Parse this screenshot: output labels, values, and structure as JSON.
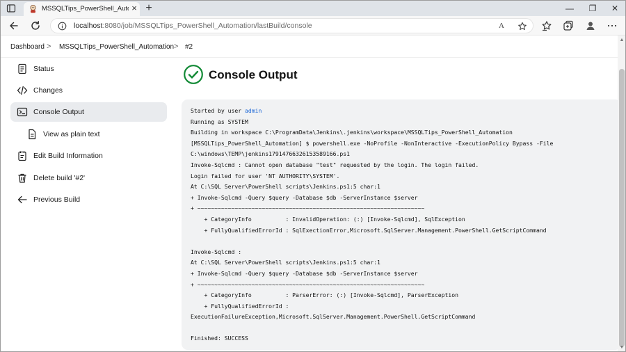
{
  "browser": {
    "tab_title": "MSSQLTips_PowerShell_Automat",
    "new_tab": "+",
    "url_host": "localhost",
    "url_rest": ":8080/job/MSSQLTips_PowerShell_Automation/lastBuild/console",
    "window_controls": [
      "—",
      "❐",
      "✕"
    ],
    "read_aloud": "A"
  },
  "breadcrumb": {
    "items": [
      "Dashboard",
      "MSSQLTips_PowerShell_Automation",
      "#2"
    ],
    "separator": ">"
  },
  "sidebar": {
    "items": [
      {
        "label": "Status",
        "icon": "status-icon"
      },
      {
        "label": "Changes",
        "icon": "code-icon"
      },
      {
        "label": "Console Output",
        "icon": "terminal-icon",
        "active": true
      },
      {
        "label": "View as plain text",
        "icon": "document-icon"
      },
      {
        "label": "Edit Build Information",
        "icon": "notepad-icon"
      },
      {
        "label": "Delete build '#2'",
        "icon": "trash-icon"
      },
      {
        "label": "Previous Build",
        "icon": "arrow-left-icon"
      }
    ]
  },
  "main": {
    "title": "Console Output",
    "status_icon": "success-check-icon",
    "status_color": "#138a36",
    "console": {
      "started_prefix": "Started by user ",
      "user": "admin",
      "lines": [
        "Running as SYSTEM",
        "Building in workspace C:\\ProgramData\\Jenkins\\.jenkins\\workspace\\MSSQLTips_PowerShell_Automation",
        "[MSSQLTips_PowerShell_Automation] $ powershell.exe -NoProfile -NonInteractive -ExecutionPolicy Bypass -File",
        "C:\\windows\\TEMP\\jenkins17914766326153589166.ps1",
        "Invoke-Sqlcmd : Cannot open database \"test\" requested by the login. The login failed.",
        "Login failed for user 'NT AUTHORITY\\SYSTEM'.",
        "At C:\\SQL Server\\PowerShell scripts\\Jenkins.ps1:5 char:1",
        "+ Invoke-Sqlcmd -Query $query -Database $db -ServerInstance $server",
        "+ ~~~~~~~~~~~~~~~~~~~~~~~~~~~~~~~~~~~~~~~~~~~~~~~~~~~~~~~~~~~~~~~~~~~",
        "    + CategoryInfo          : InvalidOperation: (:) [Invoke-Sqlcmd], SqlException",
        "    + FullyQualifiedErrorId : SqlExectionError,Microsoft.SqlServer.Management.PowerShell.GetScriptCommand",
        "",
        "Invoke-Sqlcmd :",
        "At C:\\SQL Server\\PowerShell scripts\\Jenkins.ps1:5 char:1",
        "+ Invoke-Sqlcmd -Query $query -Database $db -ServerInstance $server",
        "+ ~~~~~~~~~~~~~~~~~~~~~~~~~~~~~~~~~~~~~~~~~~~~~~~~~~~~~~~~~~~~~~~~~~~",
        "    + CategoryInfo          : ParserError: (:) [Invoke-Sqlcmd], ParserException",
        "    + FullyQualifiedErrorId :",
        "ExecutionFailureException,Microsoft.SqlServer.Management.PowerShell.GetScriptCommand",
        "",
        "Finished: SUCCESS"
      ]
    }
  }
}
